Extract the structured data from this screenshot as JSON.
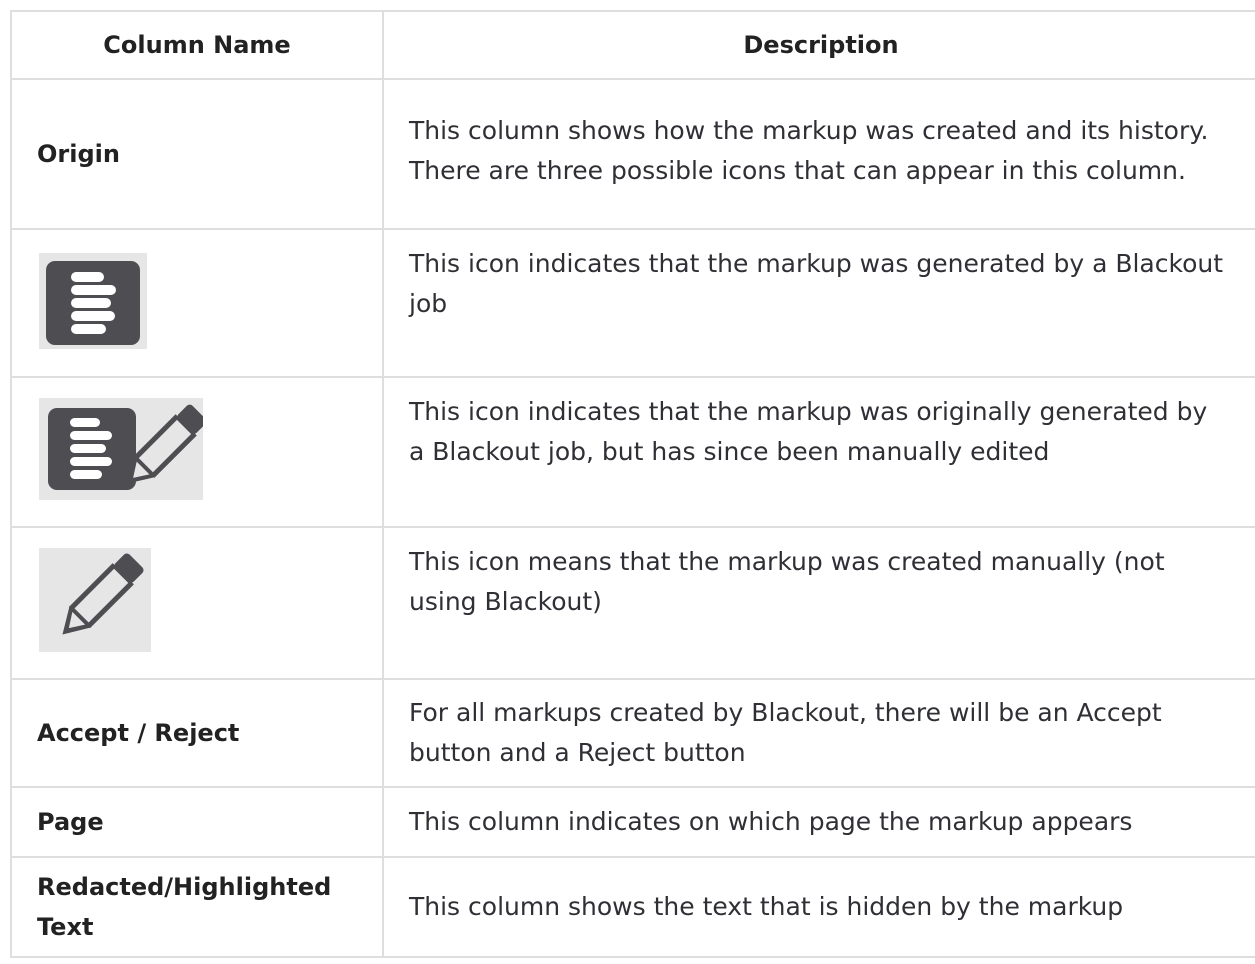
{
  "table": {
    "headers": {
      "name": "Column Name",
      "description": "Description"
    },
    "rows": [
      {
        "name": "Origin",
        "description": "This column shows how the markup was created and its history. There are three possible icons that can appear in this column."
      },
      {
        "icon": "blackout-job-icon",
        "description": "This icon indicates that the markup was generated by a Blackout job"
      },
      {
        "icon": "blackout-job-edited-icon",
        "description": "This icon indicates that the markup was originally generated by a Blackout job, but has since been manually edited"
      },
      {
        "icon": "manual-pencil-icon",
        "description": "This icon means that the markup was created manually (not using Blackout)"
      },
      {
        "name": "Accept / Reject",
        "description": "For all markups created by Blackout, there will be an Accept button and a Reject button"
      },
      {
        "name": "Page",
        "description": "This column indicates on which page the markup appears"
      },
      {
        "name": "Redacted/Highlighted Text",
        "description": "This column shows the text that is hidden by the markup"
      }
    ]
  },
  "colors": {
    "border": "#dedede",
    "icon_dark": "#4d4d52",
    "icon_bg": "#e6e6e6"
  }
}
